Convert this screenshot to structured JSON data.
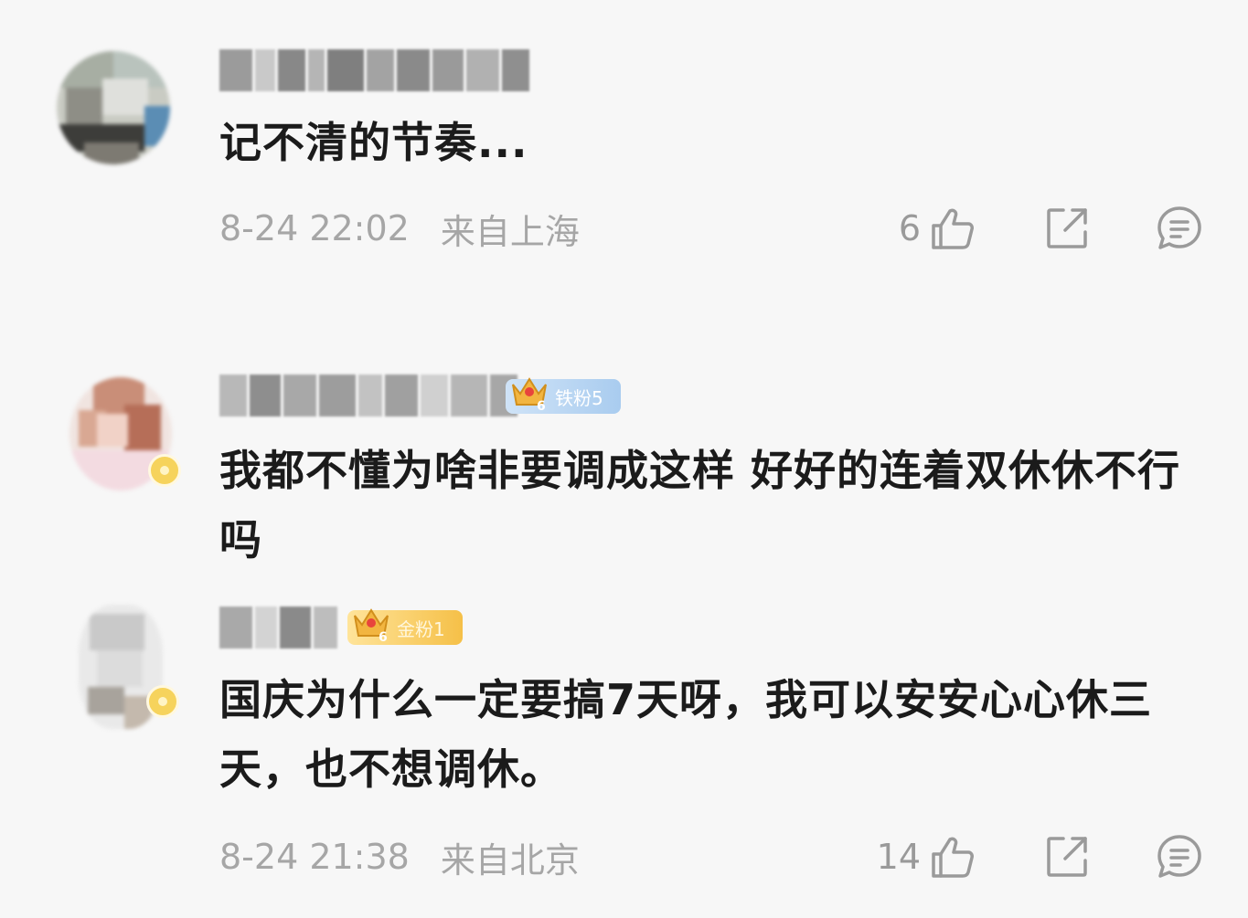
{
  "comments": [
    {
      "content": "记不清的节奏...",
      "time": "8-24 22:02",
      "location": "来自上海",
      "likes": "6",
      "badge": null
    },
    {
      "content": "我都不懂为啥非要调成这样 好好的连着双休休不行吗",
      "badge": {
        "label": "铁粉5",
        "level": "6"
      }
    },
    {
      "content": "国庆为什么一定要搞7天呀，我可以安安心心休三天，也不想调休。",
      "time": "8-24 21:38",
      "location": "来自北京",
      "likes": "14",
      "badge": {
        "label": "金粉1",
        "level": "6"
      }
    }
  ],
  "icons": {
    "like": "thumbs-up-icon",
    "share": "share-icon",
    "reply": "comment-icon"
  },
  "colors": {
    "background": "#f7f7f7",
    "meta_text": "#a6a6a6",
    "content_text": "#1b1b1b",
    "tie_badge": "#b6d4f1",
    "jin_badge": "#f7cd5c"
  }
}
